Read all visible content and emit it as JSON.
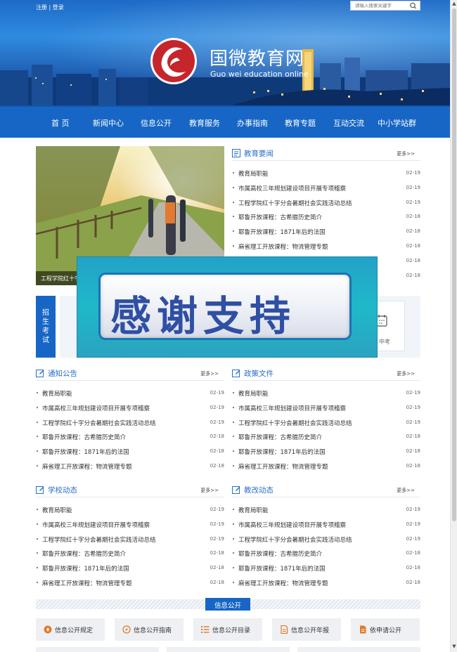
{
  "header": {
    "register": "注册",
    "separator": "|",
    "login": "登录",
    "search_placeholder": "请输入搜索关键字",
    "brand_cn": "国微教育网",
    "brand_en": "Guo wei education online"
  },
  "nav": [
    "首 页",
    "新闻中心",
    "信息公开",
    "教育服务",
    "办事指南",
    "教育专题",
    "互动交流",
    "中小学站群"
  ],
  "featured": {
    "caption": "工程学院红十字分会暑期社会实践活动总结"
  },
  "sections": {
    "edu_news": {
      "title": "教育要闻",
      "more": "更多>>",
      "items": [
        {
          "t": "教育局职能",
          "d": "02-19"
        },
        {
          "t": "市属高校三年规划建设项目开展专项稽察",
          "d": "02-19"
        },
        {
          "t": "工程学院红十字分会暑期社会实践活动总结",
          "d": "02-19"
        },
        {
          "t": "耶鲁开放课程：古希腊历史简介",
          "d": "02-18"
        },
        {
          "t": "耶鲁开放课程：1871年后的法国",
          "d": "02-18"
        },
        {
          "t": "麻省理工开放课程：物流管理专题",
          "d": "02-18"
        },
        {
          "t": "",
          "d": "02-18"
        },
        {
          "t": "",
          "d": "02-18"
        }
      ]
    },
    "notice": {
      "title": "通知公告",
      "more": "更多>>",
      "items": [
        {
          "t": "教育局职能",
          "d": "02-19"
        },
        {
          "t": "市属高校三年规划建设项目开展专项稽察",
          "d": "02-19"
        },
        {
          "t": "工程学院红十字分会暑期社会实践活动总结",
          "d": "02-19"
        },
        {
          "t": "耶鲁开放课程：古希腊历史简介",
          "d": "02-18"
        },
        {
          "t": "耶鲁开放课程：1871年后的法国",
          "d": "02-18"
        },
        {
          "t": "麻省理工开放课程：物流管理专题",
          "d": "02-18"
        }
      ]
    },
    "policy": {
      "title": "政策文件",
      "more": "更多>>",
      "items": [
        {
          "t": "教育局职能",
          "d": "02-19"
        },
        {
          "t": "市属高校三年规划建设项目开展专项稽察",
          "d": "02-19"
        },
        {
          "t": "工程学院红十字分会暑期社会实践活动总结",
          "d": "02-19"
        },
        {
          "t": "耶鲁开放课程：古希腊历史简介",
          "d": "02-18"
        },
        {
          "t": "耶鲁开放课程：1871年后的法国",
          "d": "02-18"
        },
        {
          "t": "麻省理工开放课程：物流管理专题",
          "d": "02-18"
        }
      ]
    },
    "school": {
      "title": "学校动态",
      "more": "更多>>",
      "items": [
        {
          "t": "教育局职能",
          "d": "02-19"
        },
        {
          "t": "市属高校三年规划建设项目开展专项稽察",
          "d": "02-19"
        },
        {
          "t": "工程学院红十字分会暑期社会实践活动总结",
          "d": "02-19"
        },
        {
          "t": "耶鲁开放课程：古希腊历史简介",
          "d": "02-18"
        },
        {
          "t": "耶鲁开放课程：1871年后的法国",
          "d": "02-18"
        },
        {
          "t": "麻省理工开放课程：物流管理专题",
          "d": "02-18"
        }
      ]
    },
    "reform": {
      "title": "教改动态",
      "more": "更多>>",
      "items": [
        {
          "t": "教育局职能",
          "d": "02-19"
        },
        {
          "t": "市属高校三年规划建设项目开展专项稽察",
          "d": "02-19"
        },
        {
          "t": "工程学院红十字分会暑期社会实践活动总结",
          "d": "02-19"
        },
        {
          "t": "耶鲁开放课程：古希腊历史简介",
          "d": "02-18"
        },
        {
          "t": "耶鲁开放课程：1871年后的法国",
          "d": "02-18"
        },
        {
          "t": "麻省理工开放课程：物流管理专题",
          "d": "02-18"
        }
      ]
    }
  },
  "admissions": {
    "label": "招生考试",
    "tile_label": "中考",
    "tile_icon": "calendar-icon"
  },
  "overlay": {
    "text": "感谢支持"
  },
  "info_public": {
    "label": "信息公开",
    "buttons": [
      {
        "label": "信息公开规定",
        "icon": "shield-icon"
      },
      {
        "label": "信息公开指南",
        "icon": "compass-icon"
      },
      {
        "label": "信息公开目录",
        "icon": "list-icon"
      },
      {
        "label": "信息公开年报",
        "icon": "document-icon"
      },
      {
        "label": "依申请公开",
        "icon": "edit-icon"
      }
    ]
  },
  "colors": {
    "primary": "#1766c5",
    "accent_orange": "#e07a2a",
    "text_blue": "#2a6ec6"
  }
}
